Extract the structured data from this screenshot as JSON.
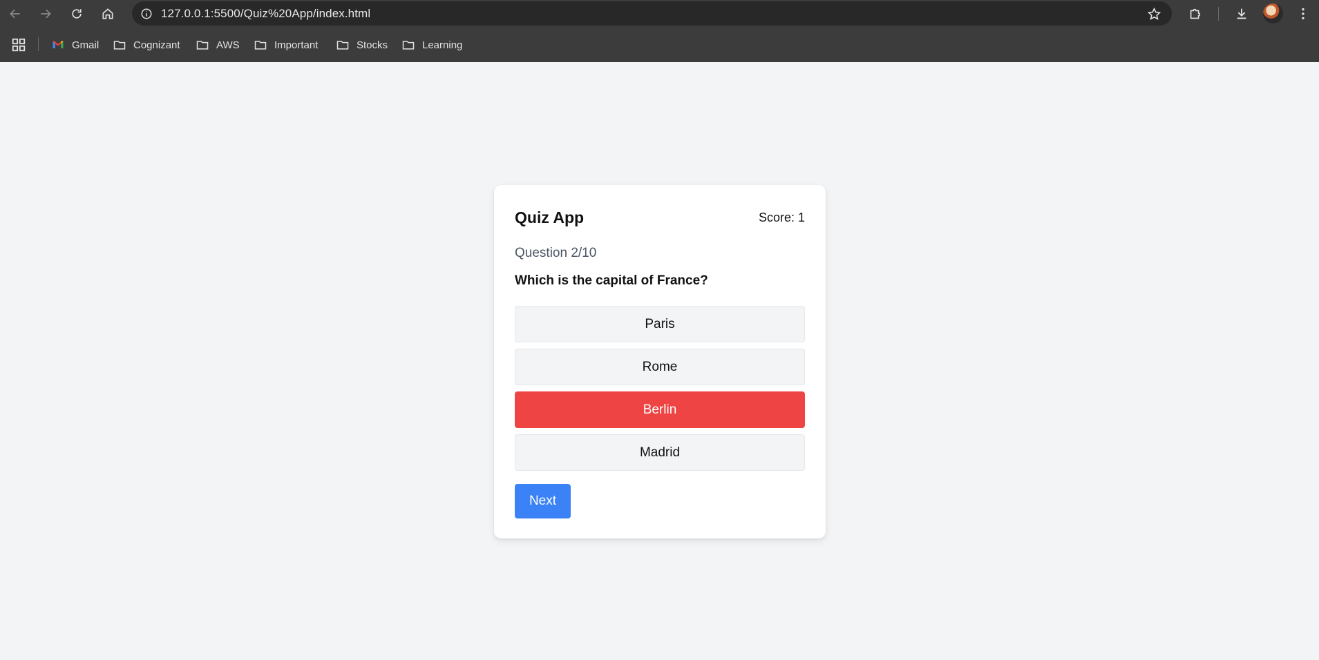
{
  "browser": {
    "url": "127.0.0.1:5500/Quiz%20App/index.html",
    "bookmarks": [
      {
        "label": "Gmail",
        "icon": "gmail-icon"
      },
      {
        "label": "Cognizant",
        "icon": "folder-icon"
      },
      {
        "label": "AWS",
        "icon": "folder-icon"
      },
      {
        "label": "Important",
        "icon": "folder-icon"
      },
      {
        "label": "Stocks",
        "icon": "folder-icon"
      },
      {
        "label": "Learning",
        "icon": "folder-icon"
      }
    ]
  },
  "quiz": {
    "title": "Quiz App",
    "score_text": "Score: 1",
    "question_counter": "Question 2/10",
    "question": "Which is the capital of France?",
    "answers": [
      {
        "label": "Paris",
        "state": "default"
      },
      {
        "label": "Rome",
        "state": "default"
      },
      {
        "label": "Berlin",
        "state": "wrong"
      },
      {
        "label": "Madrid",
        "state": "default"
      }
    ],
    "next_label": "Next"
  },
  "colors": {
    "page_background": "#f3f4f6",
    "wrong_answer": "#ef4444",
    "primary_button": "#3b82f6",
    "chrome_dark": "#3c3c3c"
  }
}
